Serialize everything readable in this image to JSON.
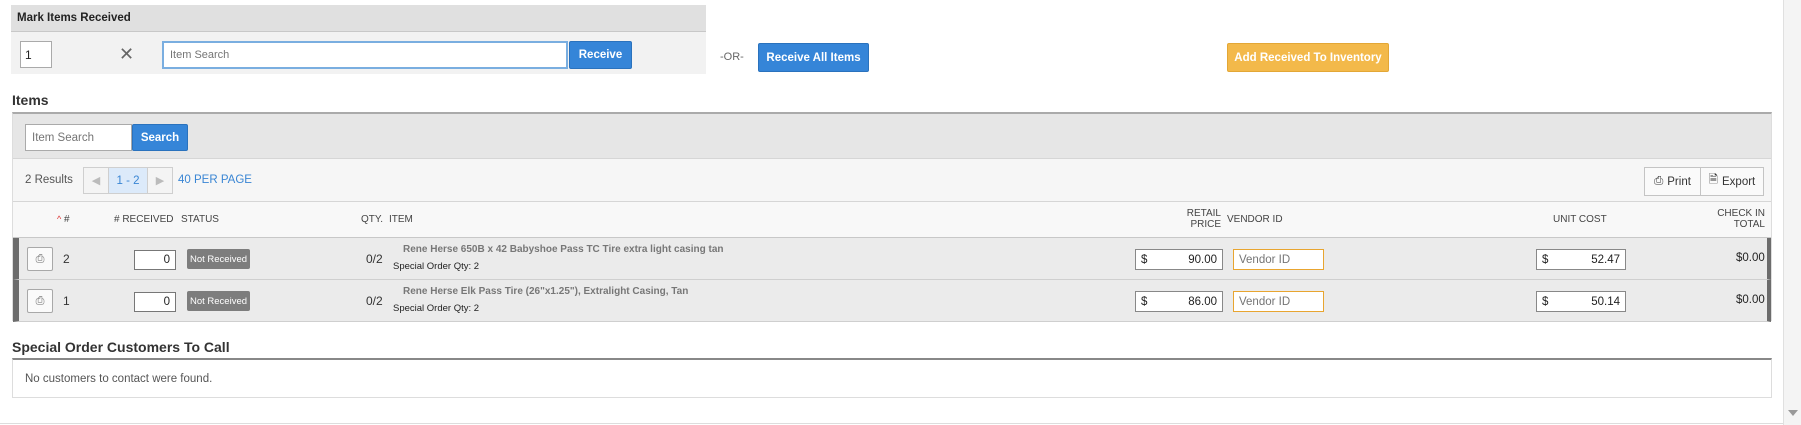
{
  "mark_panel": {
    "title": "Mark Items Received",
    "qty_value": "1",
    "search_placeholder": "Item Search",
    "receive_label": "Receive",
    "or_label": "-OR-",
    "receive_all_label": "Receive All Items",
    "add_inventory_label": "Add Received To Inventory"
  },
  "items": {
    "title": "Items",
    "search_placeholder": "Item Search",
    "search_label": "Search",
    "results": "2 Results",
    "page_range": "1 - 2",
    "per_page": "40 PER PAGE",
    "print_label": "Print",
    "export_label": "Export",
    "columns": {
      "num": "#",
      "received": "# RECEIVED",
      "status": "STATUS",
      "qty": "QTY.",
      "item": "ITEM",
      "retail_line1": "RETAIL",
      "retail_line2": "PRICE",
      "vendor_id": "VENDOR ID",
      "unit_cost": "UNIT COST",
      "checkin_line1": "CHECK IN",
      "checkin_line2": "TOTAL"
    },
    "rows": [
      {
        "num": "2",
        "received": "0",
        "status": "Not Received",
        "qty": "0/2",
        "item_name": "Rene Herse 650B x 42 Babyshoe Pass TC Tire extra light casing tan",
        "special_qty": "Special Order Qty: 2",
        "currency": "$",
        "retail_price": "90.00",
        "vendor_placeholder": "Vendor ID",
        "unit_cost": "52.47",
        "checkin_total": "$0.00"
      },
      {
        "num": "1",
        "received": "0",
        "status": "Not Received",
        "qty": "0/2",
        "item_name": "Rene Herse Elk Pass Tire (26\"x1.25\"), Extralight Casing, Tan",
        "special_qty": "Special Order Qty: 2",
        "currency": "$",
        "retail_price": "86.00",
        "vendor_placeholder": "Vendor ID",
        "unit_cost": "50.14",
        "checkin_total": "$0.00"
      }
    ]
  },
  "special_orders": {
    "title": "Special Order Customers To Call",
    "empty_message": "No customers to contact were found."
  },
  "colors": {
    "primary_button": "#3585d8",
    "warning_button": "#f3b94a",
    "status_badge": "#7d7d7d",
    "vendor_border": "#e8a530"
  },
  "icons": [
    "close-icon",
    "chevron-left-icon",
    "chevron-right-icon",
    "printer-icon",
    "export-icon",
    "sort-caret-icon"
  ]
}
